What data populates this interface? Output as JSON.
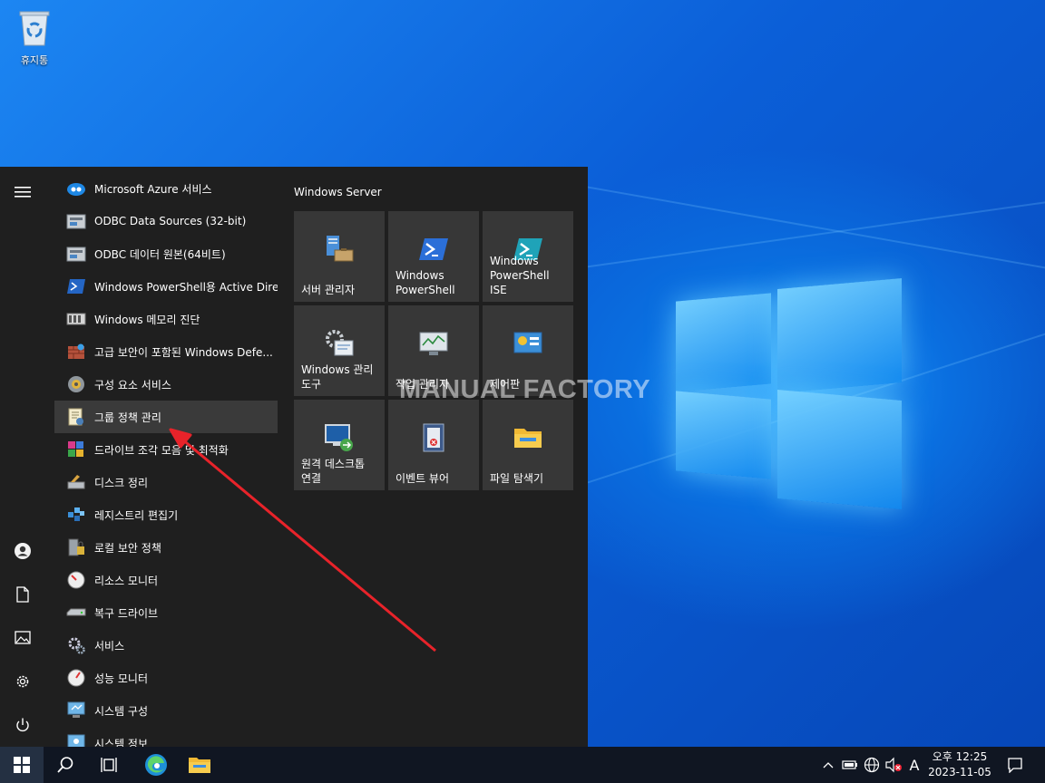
{
  "desktop": {
    "recycle_bin_label": "휴지통",
    "watermark": "MANUAL FACTORY"
  },
  "start_menu": {
    "rail": {
      "menu_icon": "hamburger-icon",
      "items": [
        {
          "icon": "user-icon"
        },
        {
          "icon": "document-icon"
        },
        {
          "icon": "pictures-icon"
        },
        {
          "icon": "settings-icon"
        },
        {
          "icon": "power-icon"
        }
      ]
    },
    "apps": [
      {
        "label": "Microsoft Azure 서비스",
        "icon": "azure-icon"
      },
      {
        "label": "ODBC Data Sources (32-bit)",
        "icon": "odbc-icon"
      },
      {
        "label": "ODBC 데이터 원본(64비트)",
        "icon": "odbc-icon"
      },
      {
        "label": "Windows PowerShell용 Active Dire...",
        "icon": "powershell-icon"
      },
      {
        "label": "Windows 메모리 진단",
        "icon": "memory-icon"
      },
      {
        "label": "고급 보안이 포함된 Windows Defe...",
        "icon": "firewall-icon"
      },
      {
        "label": "구성 요소 서비스",
        "icon": "component-services-icon"
      },
      {
        "label": "그룹 정책 관리",
        "icon": "group-policy-icon",
        "selected": true
      },
      {
        "label": "드라이브 조각 모음 및 최적화",
        "icon": "defrag-icon"
      },
      {
        "label": "디스크 정리",
        "icon": "disk-cleanup-icon"
      },
      {
        "label": "레지스트리 편집기",
        "icon": "registry-icon"
      },
      {
        "label": "로컬 보안 정책",
        "icon": "local-security-icon"
      },
      {
        "label": "리소스 모니터",
        "icon": "resource-monitor-icon"
      },
      {
        "label": "복구 드라이브",
        "icon": "recovery-drive-icon"
      },
      {
        "label": "서비스",
        "icon": "services-gear-icon"
      },
      {
        "label": "성능 모니터",
        "icon": "performance-monitor-icon"
      },
      {
        "label": "시스템 구성",
        "icon": "system-config-icon"
      },
      {
        "label": "시스템 정보",
        "icon": "system-info-icon"
      }
    ],
    "tiles_group": "Windows Server",
    "tiles": [
      {
        "label": "서버 관리자",
        "icon": "server-manager-icon"
      },
      {
        "label": "Windows\nPowerShell",
        "icon": "powershell-icon"
      },
      {
        "label": "Windows\nPowerShell ISE",
        "icon": "powershell-ise-icon"
      },
      {
        "label": "Windows 관리\n도구",
        "icon": "admin-tools-icon"
      },
      {
        "label": "작업 관리자",
        "icon": "task-manager-icon"
      },
      {
        "label": "제어판",
        "icon": "control-panel-icon"
      },
      {
        "label": "원격 데스크톱\n연결",
        "icon": "remote-desktop-icon"
      },
      {
        "label": "이벤트 뷰어",
        "icon": "event-viewer-icon"
      },
      {
        "label": "파일 탐색기",
        "icon": "file-explorer-icon"
      }
    ]
  },
  "taskbar": {
    "items": [
      {
        "icon": "windows-start-icon"
      },
      {
        "icon": "search-icon"
      },
      {
        "icon": "task-view-icon"
      },
      {
        "icon": "edge-icon"
      },
      {
        "icon": "file-explorer-icon"
      }
    ],
    "tray": {
      "ime_indicator": "A",
      "time": "오후 12:25",
      "date": "2023-11-05"
    }
  },
  "annotation": {
    "arrow_color": "#e8232a"
  }
}
